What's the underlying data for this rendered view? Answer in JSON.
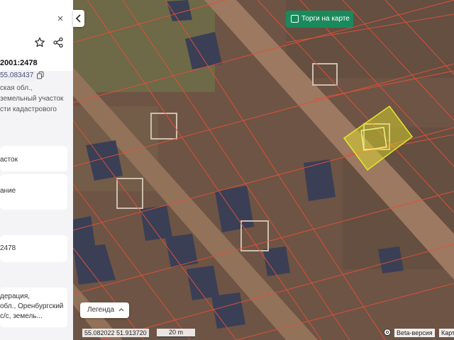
{
  "panel": {
    "cadastral_number": "2001:2478",
    "coordinates_partial": "55.083437",
    "description_lines": [
      "ская обл.,",
      "земельный участок",
      "сти кадастрового"
    ],
    "card_lines": [
      "асток",
      "ание",
      "2478"
    ],
    "address_lines": [
      "дерация,",
      "обл., Оренбургский",
      "с/с, земель..."
    ],
    "icons": {
      "close": "close-icon",
      "favorite": "star-icon",
      "share": "share-icon",
      "copy": "copy-icon"
    }
  },
  "map": {
    "torgi_button_label": "Торги на карте",
    "legend_label": "Легенда",
    "coords_readout": "55.082022  51.913720",
    "scale_label": "20 m",
    "beta_label": "Beta-версия",
    "map_label": "Карт",
    "colors": {
      "accent_green": "#1a8a5c",
      "parcel_lines": "#e0503a",
      "selected_parcel": "#e6e62a"
    },
    "icons": {
      "collapse": "chevron-left-icon",
      "legend": "chevron-up-icon",
      "settings": "gear-icon",
      "checkbox": "checkbox-icon"
    }
  }
}
